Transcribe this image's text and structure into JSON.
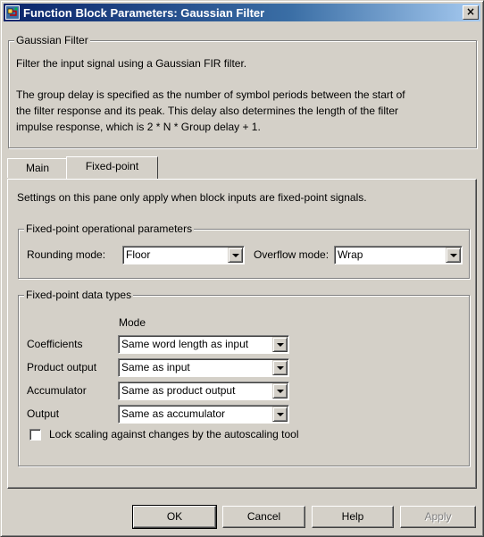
{
  "window": {
    "title": "Function Block Parameters: Gaussian Filter",
    "close_glyph": "×"
  },
  "block": {
    "group_title": "Gaussian Filter",
    "description_line1": "Filter the input signal using a Gaussian FIR filter.",
    "description_para2": [
      "The group delay is specified as the number of symbol periods between the start of",
      "the filter response and its peak. This delay also determines the length of the filter",
      "impulse response, which is 2 * N * Group delay + 1."
    ]
  },
  "tabs": [
    {
      "label": "Main",
      "active": false
    },
    {
      "label": "Fixed-point",
      "active": true
    }
  ],
  "fixed_point": {
    "note": "Settings on this pane only apply when block inputs are fixed-point signals.",
    "operational": {
      "group_title": "Fixed-point operational parameters",
      "rounding_label": "Rounding mode:",
      "rounding_value": "Floor",
      "overflow_label": "Overflow mode:",
      "overflow_value": "Wrap"
    },
    "data_types": {
      "group_title": "Fixed-point data types",
      "mode_header": "Mode",
      "rows": [
        {
          "label": "Coefficients",
          "value": "Same word length as input"
        },
        {
          "label": "Product output",
          "value": "Same as input"
        },
        {
          "label": "Accumulator",
          "value": "Same as product output"
        },
        {
          "label": "Output",
          "value": "Same as accumulator"
        }
      ],
      "lock_scaling_label": "Lock scaling against changes by the autoscaling tool",
      "lock_scaling_checked": false
    }
  },
  "buttons": {
    "ok": "OK",
    "cancel": "Cancel",
    "help": "Help",
    "apply": "Apply"
  },
  "colors": {
    "face": "#d4d0c8",
    "title_start": "#0a246a",
    "title_end": "#a6caf0",
    "disabled_text": "#808080"
  },
  "icons": {
    "title": "simulink-block-icon",
    "dropdown": "chevron-down-icon"
  }
}
